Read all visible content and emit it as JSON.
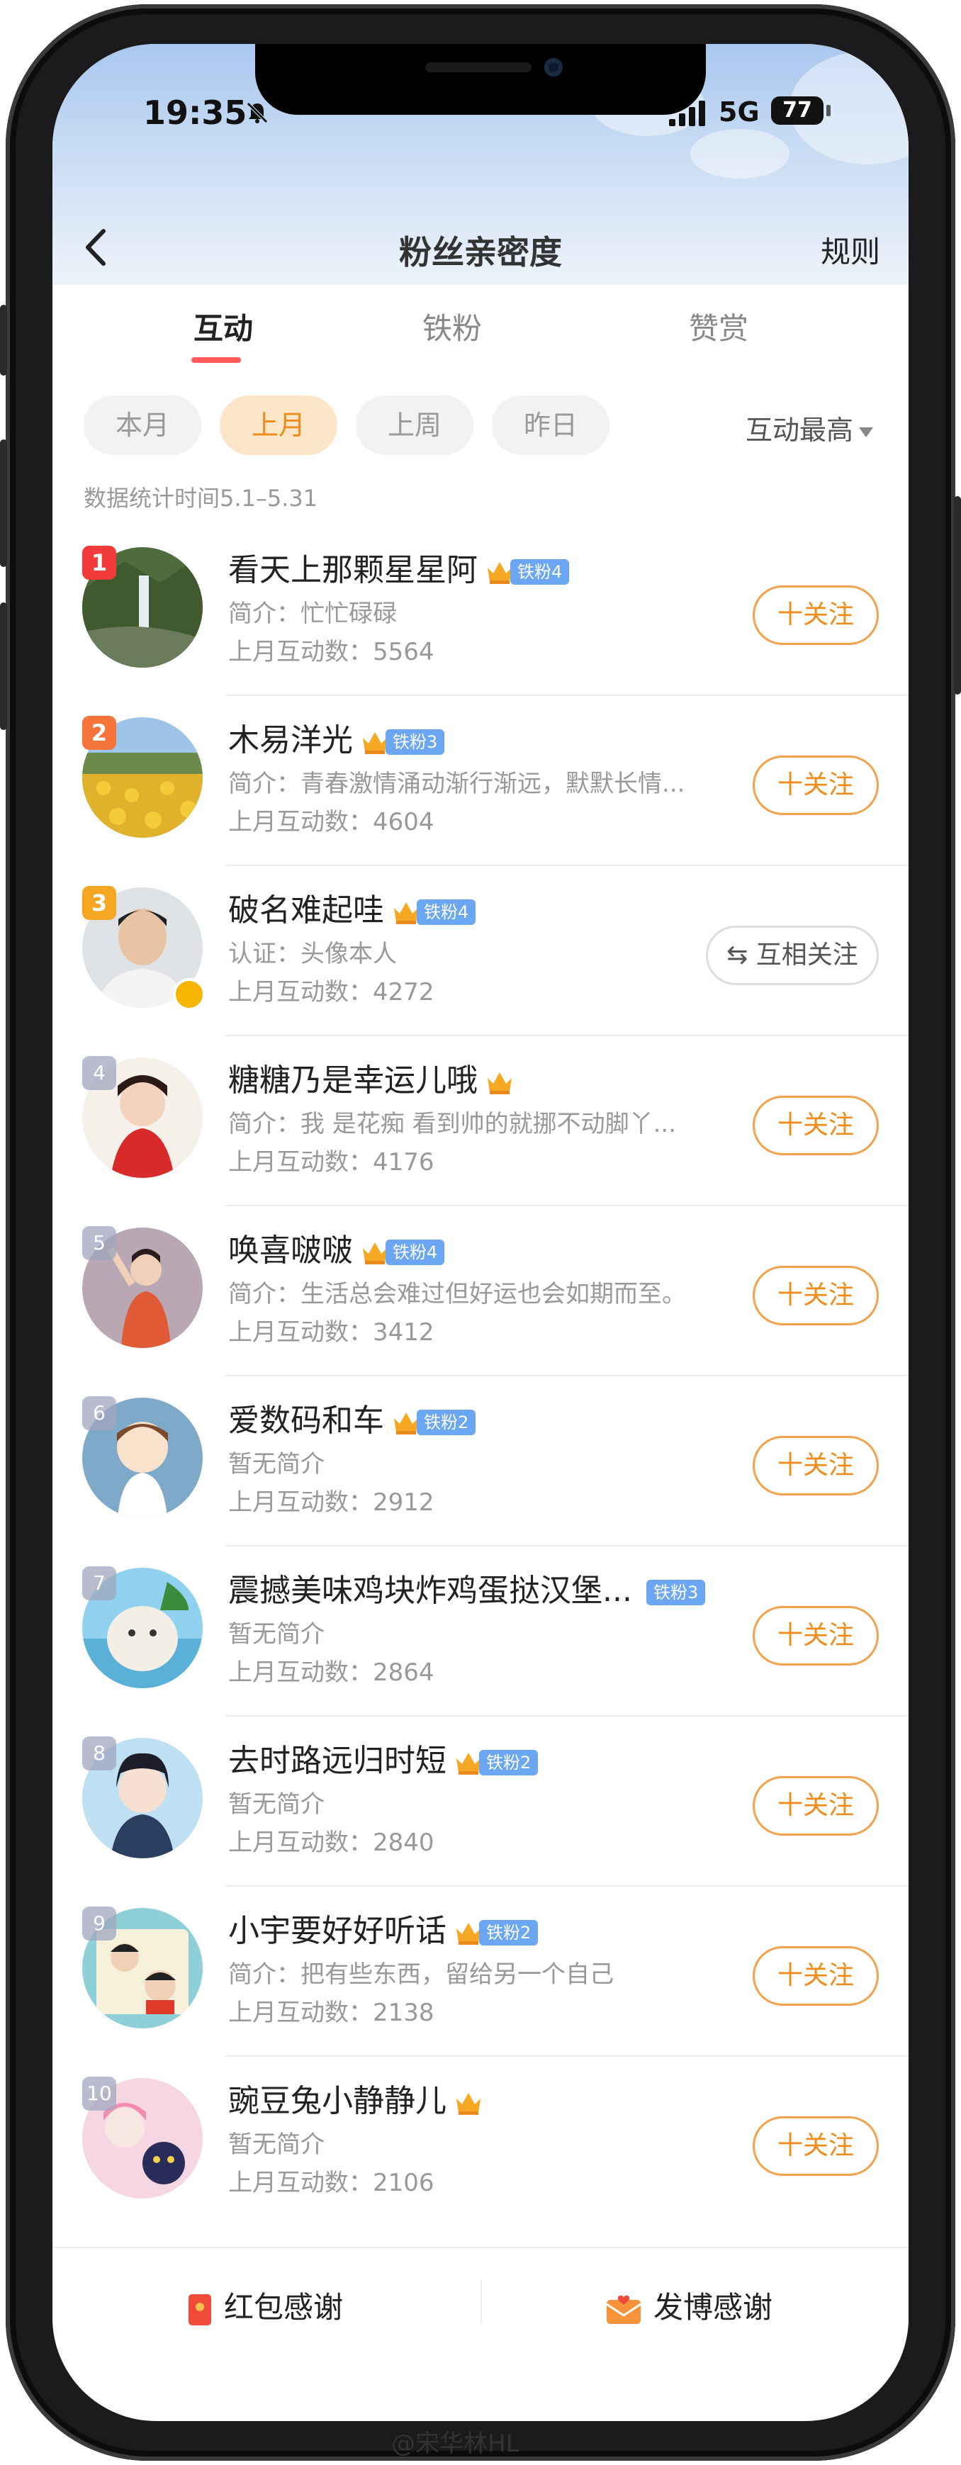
{
  "status_bar": {
    "time": "19:35",
    "network": "5G",
    "battery": "77"
  },
  "header": {
    "title": "粉丝亲密度",
    "rules": "规则"
  },
  "tabs": [
    {
      "label": "互动",
      "active": true
    },
    {
      "label": "铁粉",
      "active": false
    },
    {
      "label": "赞赏",
      "active": false
    }
  ],
  "filters": [
    {
      "label": "本月",
      "active": false
    },
    {
      "label": "上月",
      "active": true
    },
    {
      "label": "上周",
      "active": false
    },
    {
      "label": "昨日",
      "active": false
    }
  ],
  "sort": {
    "label": "互动最高"
  },
  "stat_time": "数据统计时间5.1–5.31",
  "fans": [
    {
      "rank": "1",
      "name": "看天上那颗星星阿",
      "badge": "铁粉4",
      "intro": "简介：忙忙碌碌",
      "count": "上月互动数：5564",
      "button": "十关注"
    },
    {
      "rank": "2",
      "name": "木易洋光",
      "badge": "铁粉3",
      "intro": "简介：青春激情涌动渐行渐远，默默长情...",
      "count": "上月互动数：4604",
      "button": "十关注"
    },
    {
      "rank": "3",
      "name": "破名难起哇",
      "badge": "铁粉4",
      "intro": "认证：头像本人",
      "count": "上月互动数：4272",
      "button": "互相关注"
    },
    {
      "rank": "4",
      "name": "糖糖乃是幸运儿哦",
      "badge": "",
      "intro": "简介：我 是花痴 看到帅的就挪不动脚丫...",
      "count": "上月互动数：4176",
      "button": "十关注"
    },
    {
      "rank": "5",
      "name": "唤喜啵啵",
      "badge": "铁粉4",
      "intro": "简介：生活总会难过但好运也会如期而至。",
      "count": "上月互动数：3412",
      "button": "十关注"
    },
    {
      "rank": "6",
      "name": "爱数码和车",
      "badge": "铁粉2",
      "intro": "暂无简介",
      "count": "上月互动数：2912",
      "button": "十关注"
    },
    {
      "rank": "7",
      "name": "震撼美味鸡块炸鸡蛋挞汉堡...",
      "badge": "铁粉3",
      "intro": "暂无简介",
      "count": "上月互动数：2864",
      "button": "十关注"
    },
    {
      "rank": "8",
      "name": "去时路远归时短",
      "badge": "铁粉2",
      "intro": "暂无简介",
      "count": "上月互动数：2840",
      "button": "十关注"
    },
    {
      "rank": "9",
      "name": "小宇要好好听话",
      "badge": "铁粉2",
      "intro": "简介：把有些东西，留给另一个自己",
      "count": "上月互动数：2138",
      "button": "十关注"
    },
    {
      "rank": "10",
      "name": "豌豆兔小静静儿",
      "badge": "",
      "intro": "暂无简介",
      "count": "上月互动数：2106",
      "button": "十关注"
    }
  ],
  "bottom": {
    "red_packet": "红包感谢",
    "post": "发博感谢"
  },
  "watermark": "@宋华林HL",
  "colors": {
    "accent": "#f08a1a",
    "tab_underline": "#ff5a5a",
    "badge": "#6aa6f2"
  }
}
